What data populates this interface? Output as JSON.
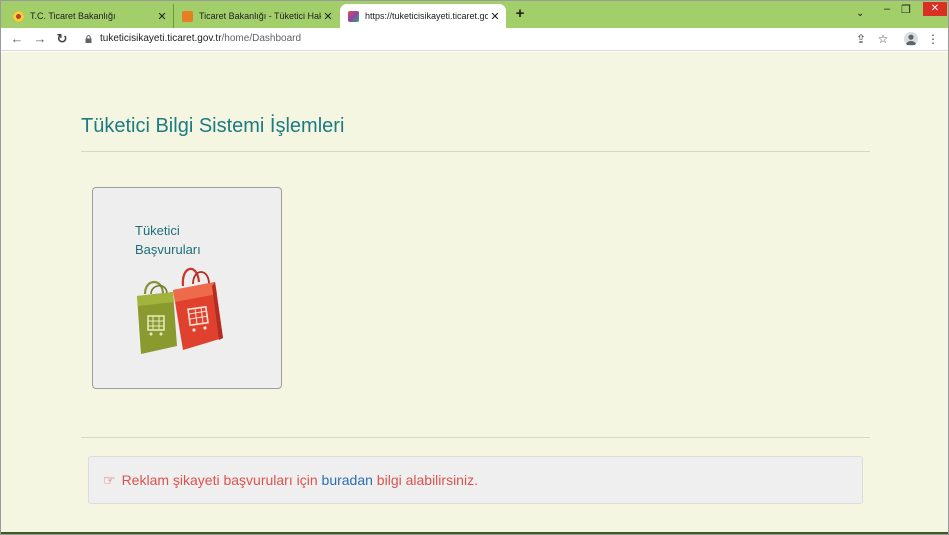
{
  "browser": {
    "tabs": [
      {
        "title": "T.C. Ticaret Bakanlığı",
        "close": "✕",
        "favicon_color": "#c0392b"
      },
      {
        "title": "Ticaret Bakanlığı - Tüketici Hakem",
        "close": "✕",
        "favicon_color": "#e67e22"
      },
      {
        "title": "https://tuketicisikayeti.ticaret.gov",
        "close": "✕",
        "favicon_color": "#8e44ad"
      }
    ],
    "new_tab": "+",
    "tab_search": "⌄",
    "window": {
      "minimize": "–",
      "restore": "❐",
      "close": "✕"
    },
    "nav": {
      "back": "←",
      "forward": "→",
      "reload": "↻"
    },
    "address": {
      "domain": "tuketicisikayeti.ticaret.gov.tr",
      "path": "/home/Dashboard"
    },
    "toolbar": {
      "share": "⇪",
      "bookmark": "☆",
      "menu": "⋮"
    }
  },
  "page": {
    "title": "Tüketici Bilgi Sistemi İşlemleri",
    "cards": [
      {
        "line1": "Tüketici",
        "line2": "Başvuruları"
      }
    ],
    "notice": {
      "hand": "☞",
      "before": "Reklam şikayeti başvuruları için ",
      "link": "buradan",
      "after": " bilgi alabilirsiniz."
    }
  },
  "colors": {
    "tabstrip": "#a3cf6a",
    "page_bg": "#f4f6e1",
    "title": "#1d7b82",
    "notice_text": "#d9534f",
    "link": "#2a6fb0"
  }
}
